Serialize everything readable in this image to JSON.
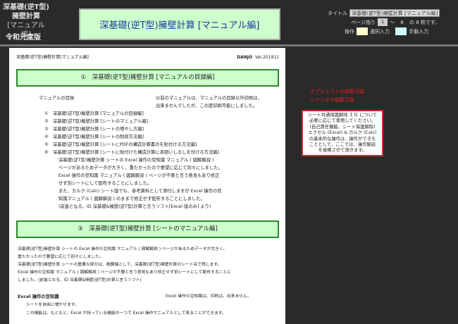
{
  "header": {
    "app_title_lines": [
      "深基礎(逆T型)",
      "擁壁計算",
      "[マニュアル編]"
    ],
    "era": "令和元度版",
    "banner": "深基礎(逆T型)擁壁計算 [マニュアル編]"
  },
  "controls": {
    "title_label": "タイトル",
    "title_value": "深基礎(逆T型)擁壁計算 [マニュアル編]",
    "page_label": "ページ指り",
    "page_from": "1",
    "tilde": "～",
    "page_to": "8",
    "page_suffix": "の 8 枚です。",
    "legend_label": "操作",
    "legend_select": "選択入力",
    "legend_manual": "手動入力",
    "color_select": "#ffffcc",
    "color_manual": "#ccffff"
  },
  "page": {
    "header_left": "深基礎(逆T型)擁壁計算[マニュアル編]",
    "header_brand": "DANJO",
    "header_ver": "Ver.201911",
    "section1": "①　深基礎(逆T型)擁壁計算 [マニュアルの目録編]",
    "toc_label": "マニュアルの目録",
    "note1": [
      "以前のマニュアルは、マニュアルの目録以外印刷は、",
      "出来ませんでしたが、この度印刷可能にしました。"
    ],
    "toc": [
      "①　深基礎(逆T型)擁壁計算 [マニュアルの目録編]",
      "②　深基礎(逆T型)擁壁計算 [シートのマニュアル編]",
      "③　深基礎(逆T型)擁壁計算 [シートの増やし方編]",
      "④　深基礎(逆T型)擁壁計算 [シートの削除方法編]",
      "⑤　深基礎(逆T型)擁壁計算 [シートにPDFの構造計算書のを貼付ける方法編]",
      "⑥　深基礎(逆T型)擁壁計算 [シートに貼付けた構造計算に赤囲いしるしを付ける方法編]"
    ],
    "para1": [
      "深基礎(逆T型)擁壁計算 シートの Excel 操作の豆知識 マニュアル ( 図解解説 )",
      "ページがあるためデータが大きく、重たかったので要望に応じて別々にしました。",
      "Excel 操作の豆知識 マニュアル ( 図解解説 ) ページが不要と言う意見もあり修正",
      "せず別シートにして配布することにしました。",
      "また、カルク (Calc) シート版でも、参考資料として添付しますが Excel 操作の豆",
      "知識マニュアル ( 図解解説 ) のままで修正せず配布することにしました。",
      "(前進となる、ID 深基礎&擁壁(逆T型)計算と言うソフト[Excel 版のみ] より)"
    ],
    "section2": "②　深基礎(逆T型)擁壁計算 [シートのマニュアル編]",
    "para2": [
      "深基礎(逆T型)擁壁計算 シートの Excel 操作の豆知識 マニュアル ( 図解解説 ) ページがあるためデータが大きく、",
      "重たかったので要望に応じて別々にしました。",
      "深基礎(逆T型)擁壁計算 シートの重要な部分は、概要編として、深基礎(逆T型)擁壁計算のシート名で残します。",
      "Excel 操作の豆知識 マニュアル ( 図解解説 ) ページが不要と言う意見もあり修正せず別シートにして配布することに",
      "しました。(前進となる、ID 深基礎&擁壁(逆T型)計算と言うソフト)"
    ],
    "tips_title": "Excel 操作の豆知識",
    "tips_note": "Excel 操作の豆知識は、印刷は、出来ません。",
    "tips": [
      "シートを自由に増やせます。",
      "この機能は、もともと、Excel が持っている機能の一つで Excel 操作マニュアルとして見ることができます。"
    ]
  },
  "side": {
    "red": [
      "オブジェクトの編集可能",
      "シナリオの編集可能"
    ],
    "note": [
      "シート共通保護解除 ＩＤ について",
      "必要に応じて使用してください。",
      "(自己責任機能、シート保護解除)",
      "エクセル (Excel) & カルク (Calc)",
      "の基本的な操作は、操作ができる",
      "こととして、ここでは、操作解説",
      "を省略させて頂きます。"
    ]
  }
}
